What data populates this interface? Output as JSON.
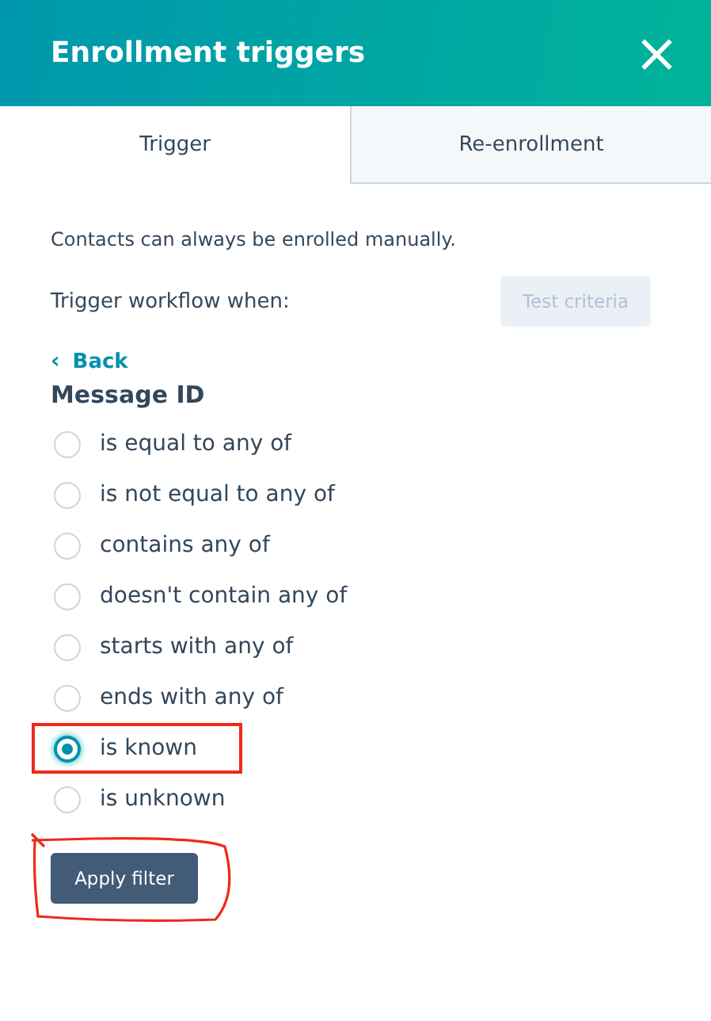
{
  "header": {
    "title": "Enrollment triggers",
    "close": "×"
  },
  "tabs": [
    {
      "label": "Trigger",
      "selected": true
    },
    {
      "label": "Re-enrollment",
      "selected": false
    }
  ],
  "note": "Contacts can always be enrolled manually.",
  "trigger_label": "Trigger workflow when:",
  "test_button": {
    "label": "Test criteria",
    "disabled": true
  },
  "back_link": {
    "icon": "‹",
    "label": "Back"
  },
  "property": "Message ID",
  "options": [
    {
      "label": "is equal to any of",
      "selected": false,
      "highlighted": false
    },
    {
      "label": "is not equal to any of",
      "selected": false,
      "highlighted": false
    },
    {
      "label": "contains any of",
      "selected": false,
      "highlighted": false
    },
    {
      "label": "doesn't contain any of",
      "selected": false,
      "highlighted": false
    },
    {
      "label": "starts with any of",
      "selected": false,
      "highlighted": false
    },
    {
      "label": "ends with any of",
      "selected": false,
      "highlighted": false
    },
    {
      "label": "is known",
      "selected": true,
      "highlighted": true
    },
    {
      "label": "is unknown",
      "selected": false,
      "highlighted": false
    }
  ],
  "apply_button": {
    "label": "Apply filter",
    "circled": true
  }
}
